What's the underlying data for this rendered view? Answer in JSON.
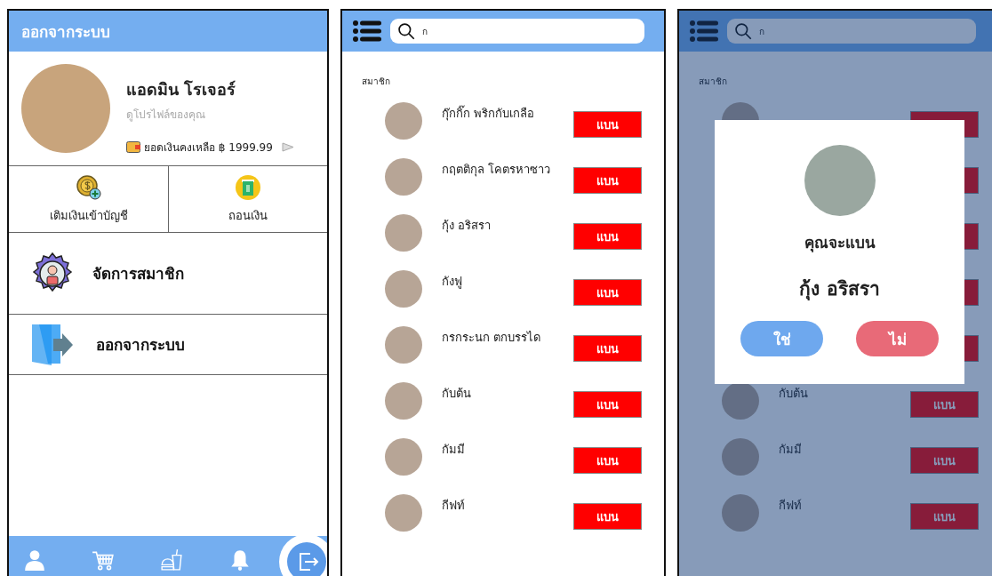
{
  "profile_screen": {
    "header": {
      "title": "ออกจากระบบ"
    },
    "profile": {
      "name": "แอดมิน โรเจอร์",
      "subtitle": "ดูโปรไฟล์ของคุณ",
      "balance": "ยอดเงินคงเหลือ ฿ 1999.99"
    },
    "actions": [
      {
        "label": "เติมเงินเข้าบัญชี",
        "kind": "deposit"
      },
      {
        "label": "ถอนเงิน",
        "kind": "withdraw"
      }
    ],
    "menu": [
      {
        "label": "จัดการสมาชิก",
        "kind": "members"
      },
      {
        "label": "ออกจากระบบ",
        "kind": "logout"
      }
    ],
    "bottom_nav": [
      {
        "kind": "profile"
      },
      {
        "kind": "cart"
      },
      {
        "kind": "food"
      },
      {
        "kind": "notifications"
      },
      {
        "kind": "logout"
      }
    ]
  },
  "members_screen": {
    "search": {
      "value": "ก"
    },
    "section_label": "สมาชิก",
    "members": [
      {
        "name": "กุ๊กกิ๊ก พริกกับเกลือ",
        "ban_label": "แบน"
      },
      {
        "name": "กฤตติกุล โคตรหาซาว",
        "ban_label": "แบน"
      },
      {
        "name": "กุ้ง อริสรา",
        "ban_label": "แบน"
      },
      {
        "name": "กังฟู",
        "ban_label": "แบน"
      },
      {
        "name": "กรกระนก ตกบรรได",
        "ban_label": "แบน"
      },
      {
        "name": "กับต้น",
        "ban_label": "แบน"
      },
      {
        "name": "กัมมี",
        "ban_label": "แบน"
      },
      {
        "name": "กีฟท์",
        "ban_label": "แบน"
      }
    ]
  },
  "ban_dialog_screen": {
    "search": {
      "value": "ก"
    },
    "section_label": "สมาชิก",
    "members": [
      {
        "name": "กับต้น",
        "ban_label": "แบน"
      },
      {
        "name": "กัมมี",
        "ban_label": "แบน"
      },
      {
        "name": "กีฟท์",
        "ban_label": "แบน"
      }
    ],
    "dialog": {
      "prompt": "คุณจะแบน",
      "member_name": "กุ้ง อริสรา",
      "buttons": [
        {
          "label": "ใช่",
          "kind": "confirm"
        },
        {
          "label": "ไม่",
          "kind": "cancel"
        }
      ]
    }
  }
}
